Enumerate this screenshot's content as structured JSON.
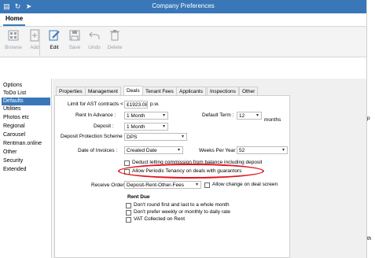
{
  "window": {
    "title": "Company Preferences"
  },
  "ribbon": {
    "tab": "Home",
    "buttons": [
      {
        "label": "Browse",
        "icon": "browse-icon"
      },
      {
        "label": "Add",
        "icon": "add-icon"
      },
      {
        "label": "Edit",
        "icon": "edit-icon"
      },
      {
        "label": "Save",
        "icon": "save-icon"
      },
      {
        "label": "Undo",
        "icon": "undo-icon"
      },
      {
        "label": "Delete",
        "icon": "delete-icon"
      }
    ]
  },
  "nav": {
    "items": [
      "Options",
      "ToDo List",
      "Defaults",
      "Utilities",
      "Photos etc",
      "Regional",
      "Carousel",
      "Rentman.online",
      "Other",
      "Security",
      "Extended"
    ],
    "selected": "Defaults"
  },
  "tabs": [
    "Properties",
    "Management",
    "Deals",
    "Tenant Fees",
    "Applicants",
    "Inspections",
    "Other"
  ],
  "deals": {
    "limit_label": "Limit for AST contracts <",
    "limit_value": "£1923.08",
    "limit_unit": "p.w.",
    "rent_advance_label": "Rent In Advance :",
    "rent_advance_value": "1 Month",
    "default_term_label": "Default Term :",
    "default_term_value": "12",
    "default_term_unit": "months",
    "deposit_label": "Deposit :",
    "deposit_value": "1 Month",
    "scheme_label": "Deposit Protection Scheme :",
    "scheme_value": "DPS",
    "invoice_date_label": "Date of Invoices :",
    "invoice_date_value": "Created Date",
    "weeks_label": "Weeks Per Year :",
    "weeks_value": "52",
    "deduct_label": "Deduct letting commission from balance including deposit",
    "periodic_label": "Allow Periodic Tenancy on deals with guarantors",
    "receive_order_label": "Receive Order :",
    "receive_order_value": "Deposit-Rent-Other-Fees",
    "allow_change_label": "Allow change on deal screen",
    "rent_due_title": "Rent Due",
    "rent_due_options": [
      {
        "label": "Don't round first and last to a whole month",
        "checked": false
      },
      {
        "label": "Don't prefer weekly or monthly to daily rate",
        "checked": false
      },
      {
        "label": "VAT Collected on Rent",
        "checked": false
      }
    ]
  },
  "edge": {
    "p": "p",
    "th": "th"
  }
}
